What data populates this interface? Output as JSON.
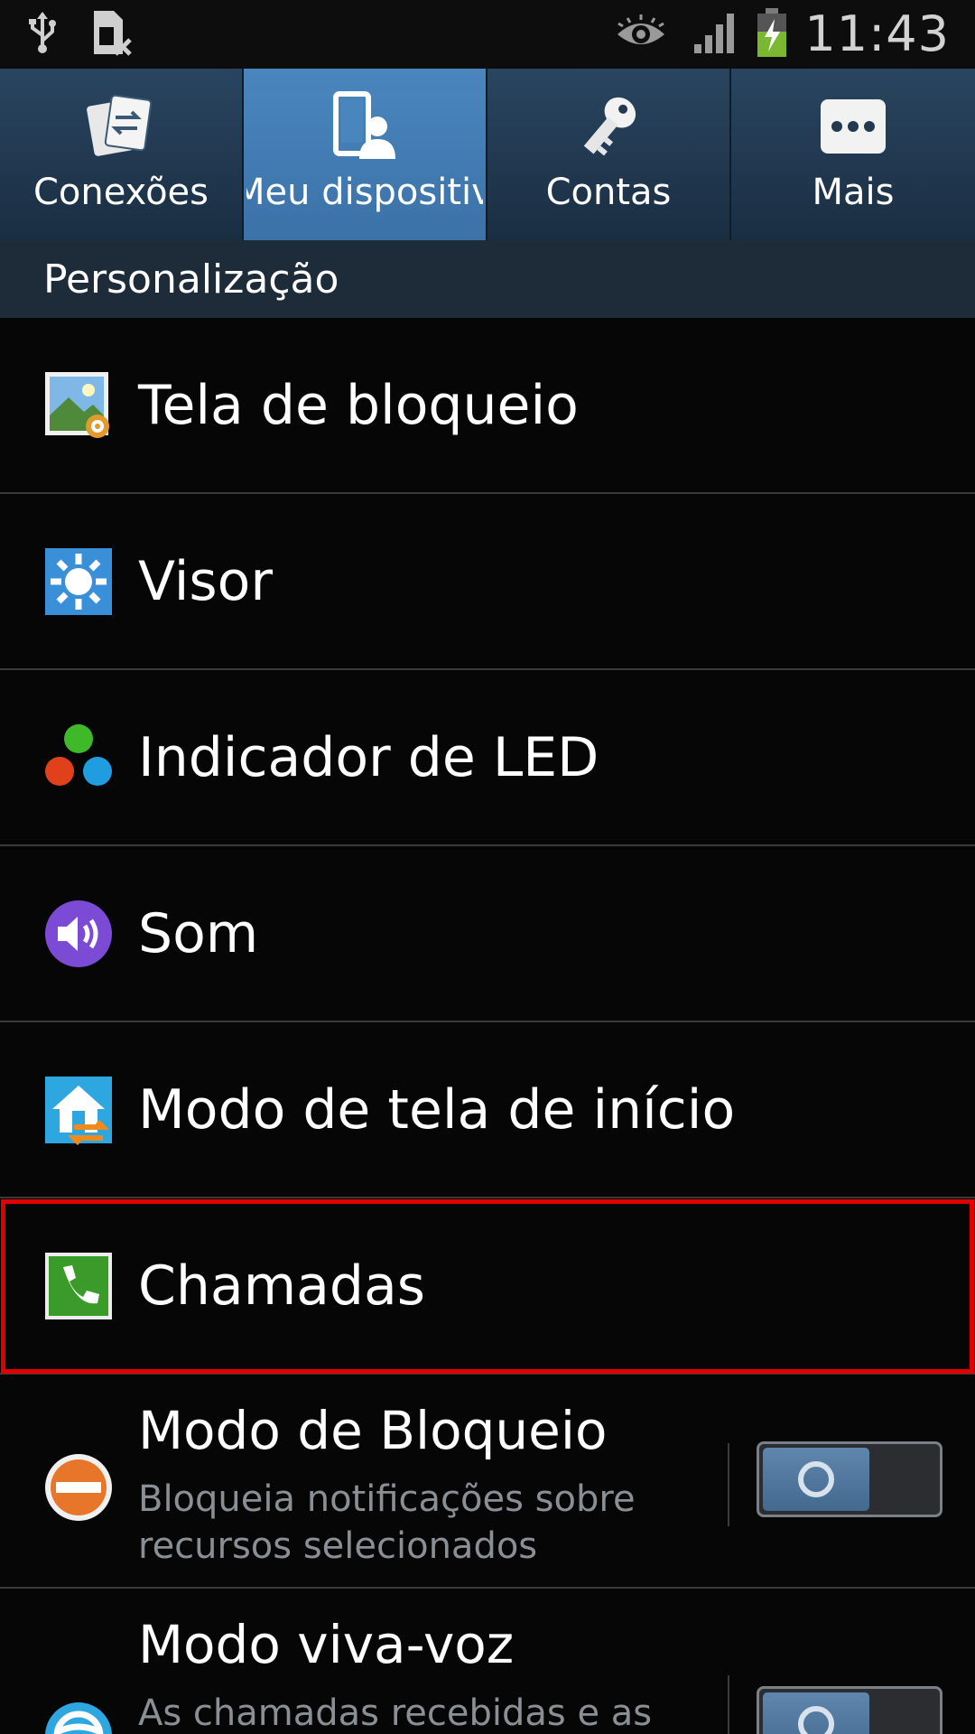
{
  "status_bar": {
    "time": "11:43",
    "icons": [
      "usb-icon",
      "no-sim-icon",
      "smart-stay-eye-icon",
      "signal-icon",
      "battery-charging-icon"
    ]
  },
  "tabs": [
    {
      "label": "Conexões",
      "icon": "connections-icon",
      "active": false
    },
    {
      "label": "Meu dispositivo",
      "icon": "my-device-icon",
      "active": true
    },
    {
      "label": "Contas",
      "icon": "accounts-key-icon",
      "active": false
    },
    {
      "label": "Mais",
      "icon": "more-icon",
      "active": false
    }
  ],
  "section": {
    "title": "Personalização"
  },
  "items": [
    {
      "label": "Tela de bloqueio",
      "icon": "lock-screen-icon"
    },
    {
      "label": "Visor",
      "icon": "display-icon"
    },
    {
      "label": "Indicador de LED",
      "icon": "led-indicator-icon"
    },
    {
      "label": "Som",
      "icon": "sound-icon"
    },
    {
      "label": "Modo de tela de início",
      "icon": "home-screen-mode-icon"
    },
    {
      "label": "Chamadas",
      "icon": "call-icon"
    }
  ],
  "toggle_items": [
    {
      "title": "Modo de Bloqueio",
      "subtitle": "Bloqueia notificações sobre recursos selecionados",
      "icon": "blocking-mode-icon",
      "enabled": false
    },
    {
      "title": "Modo viva-voz",
      "subtitle": "As chamadas recebidas e as",
      "icon": "driving-mode-icon",
      "enabled": false
    }
  ],
  "colors": {
    "highlight": "#e00000",
    "tab_active": "#4a86be",
    "header_bg": "#1e2c39"
  }
}
